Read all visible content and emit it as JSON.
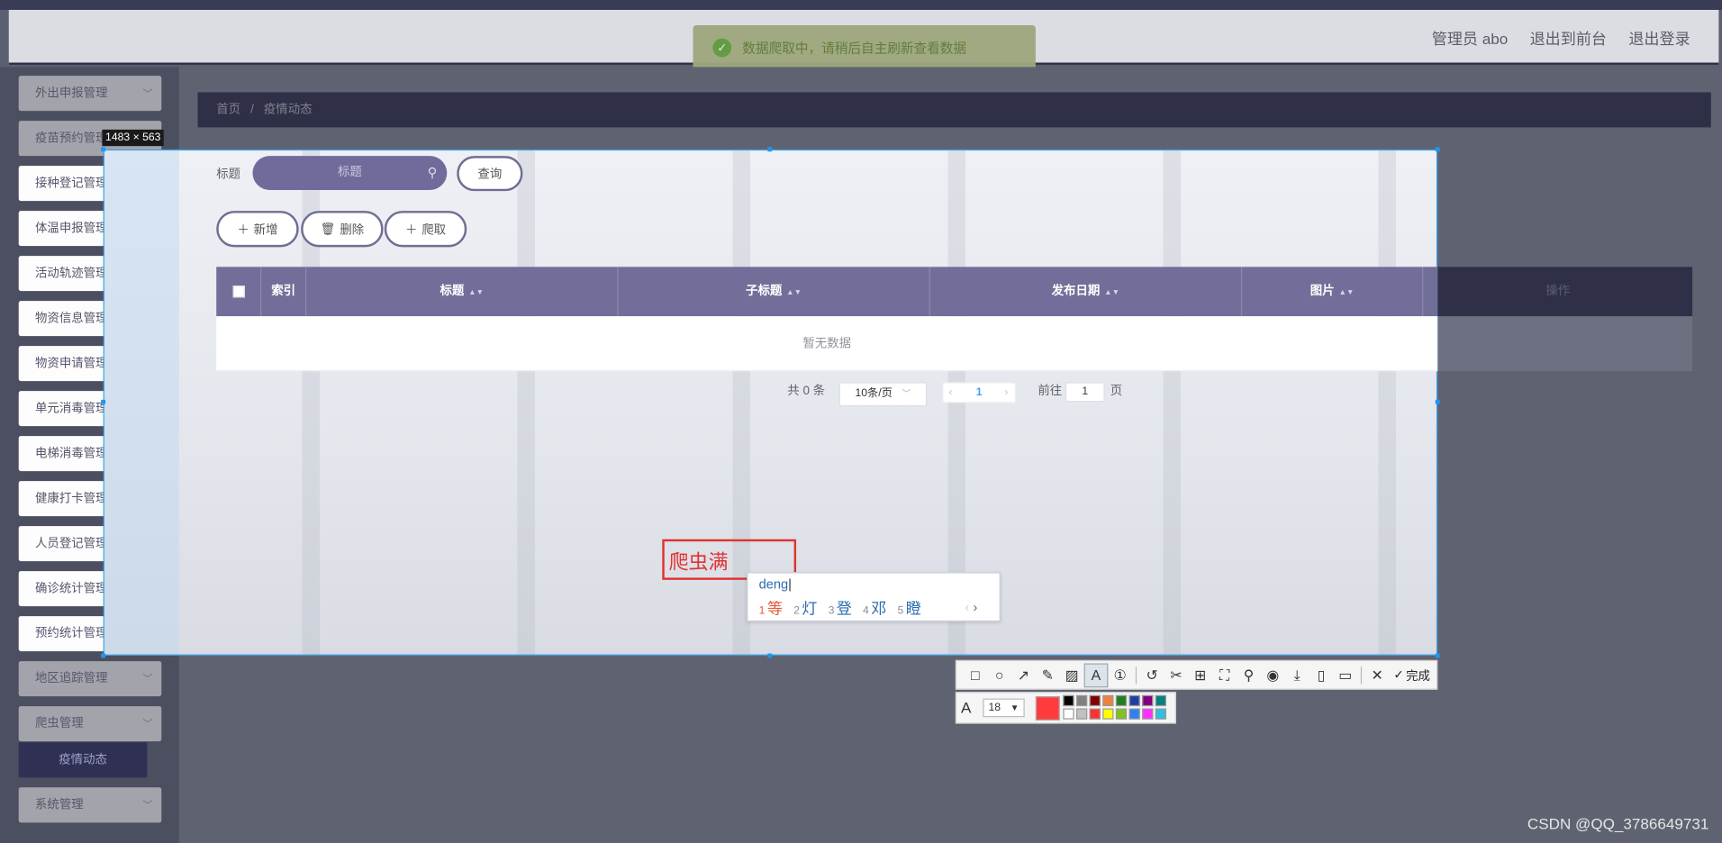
{
  "header": {
    "admin_label": "管理员 abo",
    "frontend_link": "退出到前台",
    "logout_link": "退出登录"
  },
  "toast": {
    "icon": "check-circle-icon",
    "message": "数据爬取中，请稍后自主刷新查看数据"
  },
  "sidebar": {
    "items": [
      {
        "label": "外出申报管理"
      },
      {
        "label": "疫苗预约管理"
      },
      {
        "label": "接种登记管理"
      },
      {
        "label": "体温申报管理"
      },
      {
        "label": "活动轨迹管理"
      },
      {
        "label": "物资信息管理"
      },
      {
        "label": "物资申请管理"
      },
      {
        "label": "单元消毒管理"
      },
      {
        "label": "电梯消毒管理"
      },
      {
        "label": "健康打卡管理"
      },
      {
        "label": "人员登记管理"
      },
      {
        "label": "确诊统计管理"
      },
      {
        "label": "预约统计管理"
      },
      {
        "label": "地区追踪管理"
      },
      {
        "label": "爬虫管理"
      }
    ],
    "active_subitem": "疫情动态",
    "system_item": "系统管理"
  },
  "breadcrumb": {
    "home": "首页",
    "separator": "/",
    "current": "疫情动态"
  },
  "screenshot_overlay": {
    "size_label": "1483 × 563",
    "selection_color": "#3aa0e6"
  },
  "search": {
    "label": "标题",
    "placeholder": "标题",
    "query_button": "查询"
  },
  "actions": {
    "add": "新增",
    "delete": "删除",
    "crawl": "爬取"
  },
  "table": {
    "columns": [
      "索引",
      "标题",
      "子标题",
      "发布日期",
      "图片",
      "操作"
    ],
    "empty_text": "暂无数据"
  },
  "pagination": {
    "total": "共 0 条",
    "page_size": "10条/页",
    "current_page": "1",
    "goto_label": "前往",
    "goto_value": "1",
    "page_unit": "页"
  },
  "annotation": {
    "text": "爬虫满"
  },
  "ime": {
    "input": "deng",
    "candidates": [
      {
        "n": "1",
        "c": "等"
      },
      {
        "n": "2",
        "c": "灯"
      },
      {
        "n": "3",
        "c": "登"
      },
      {
        "n": "4",
        "c": "邓"
      },
      {
        "n": "5",
        "c": "瞪"
      }
    ]
  },
  "capture_toolbar": {
    "done_label": "完成",
    "font_size": "18",
    "current_color": "#ff3b3b",
    "palette": [
      "#000000",
      "#808080",
      "#800000",
      "#f08040",
      "#208020",
      "#2040a0",
      "#800080",
      "#008080",
      "#ffffff",
      "#c0c0c0",
      "#ff3030",
      "#ffff00",
      "#80c020",
      "#3080f0",
      "#ff30ff",
      "#30c0e0"
    ]
  },
  "watermark": "CSDN @QQ_3786649731"
}
